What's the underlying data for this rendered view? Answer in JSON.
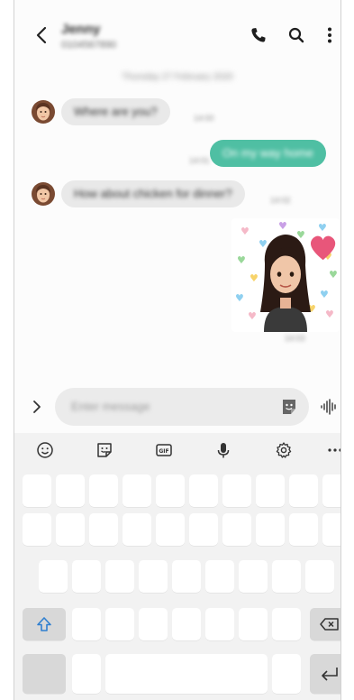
{
  "header": {
    "contact_name": "Jenny",
    "contact_number": "0104567890"
  },
  "conversation": {
    "date": "Thursday 27 February 2020",
    "messages": [
      {
        "direction": "incoming",
        "text": "Where are you?",
        "time": "14:00"
      },
      {
        "direction": "outgoing",
        "text": "On my way home",
        "time": "14:01"
      },
      {
        "direction": "incoming",
        "text": "How about chicken for dinner?",
        "time": "14:02"
      },
      {
        "direction": "outgoing",
        "type": "sticker",
        "sticker_icon": "ar-emoji-sticker",
        "time": "14:03"
      }
    ]
  },
  "composer": {
    "placeholder": "Enter message"
  },
  "keyboard": {
    "toolbar_icons": [
      "emoji-icon",
      "sticker-icon",
      "gif-icon",
      "microphone-icon",
      "settings-gear-icon",
      "more-icon"
    ],
    "gif_label": "GIF",
    "bubble_outgoing_color": "#4fbfa3",
    "bubble_incoming_color": "#e9e9e9"
  }
}
